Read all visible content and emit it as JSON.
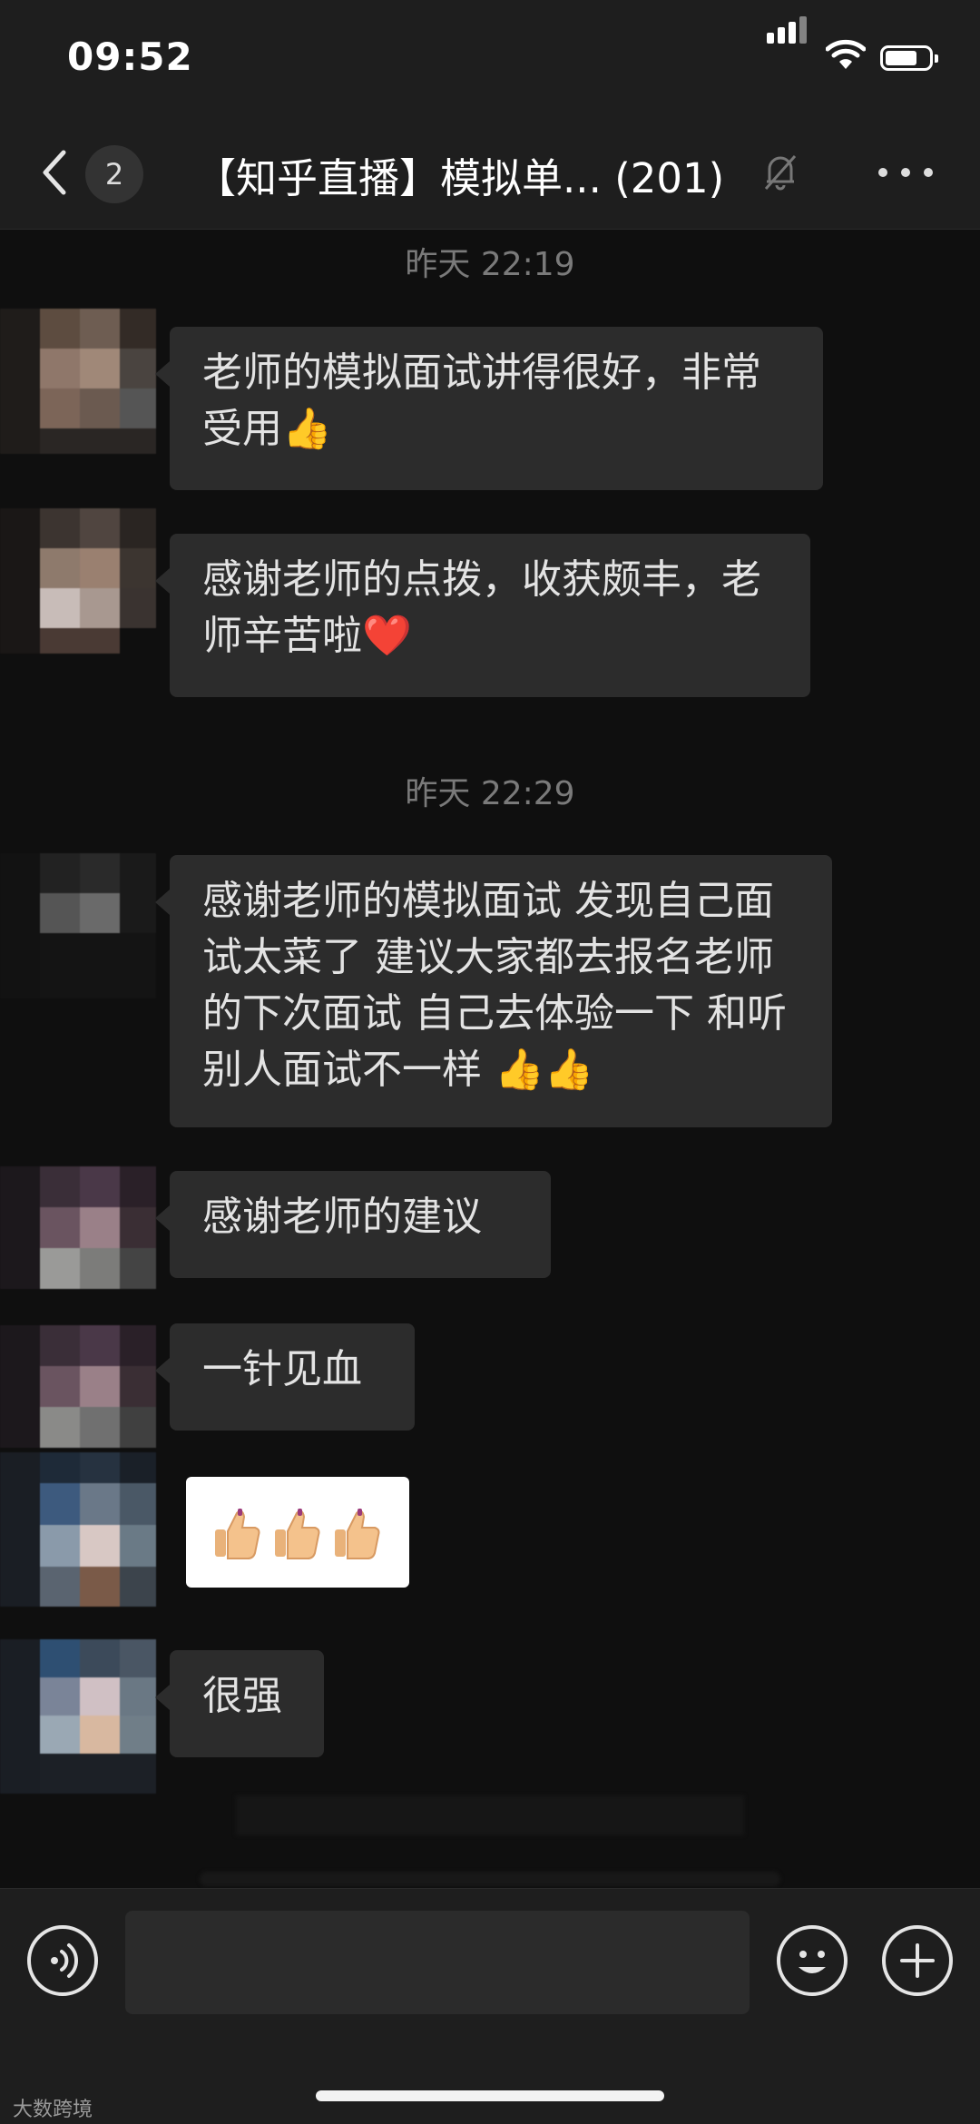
{
  "status_bar": {
    "time": "09:52"
  },
  "nav": {
    "unread_count": "2",
    "title": "【知乎直播】模拟单... (201)"
  },
  "messages": [
    {
      "type": "time",
      "text": "昨天 22:19"
    },
    {
      "type": "text",
      "text": "老师的模拟面试讲得很好，非常受用👍"
    },
    {
      "type": "text",
      "text": "感谢老师的点拨，收获颇丰，老师辛苦啦❤️"
    },
    {
      "type": "time",
      "text": "昨天 22:29"
    },
    {
      "type": "text",
      "text": "感谢老师的模拟面试 发现自己面试太菜了 建议大家都去报名老师的下次面试 自己去体验一下 和听别人面试不一样 👍👍"
    },
    {
      "type": "text",
      "text": "感谢老师的建议"
    },
    {
      "type": "text",
      "text": "一针见血"
    },
    {
      "type": "image",
      "emoji": "👍👍👍"
    },
    {
      "type": "text",
      "text": "很强"
    }
  ],
  "input": {
    "value": "",
    "placeholder": ""
  },
  "watermark": "大数跨境",
  "colors": {
    "background": "#0f0f0f",
    "bar": "#1e1e1e",
    "bubble": "#2c2c2c"
  }
}
